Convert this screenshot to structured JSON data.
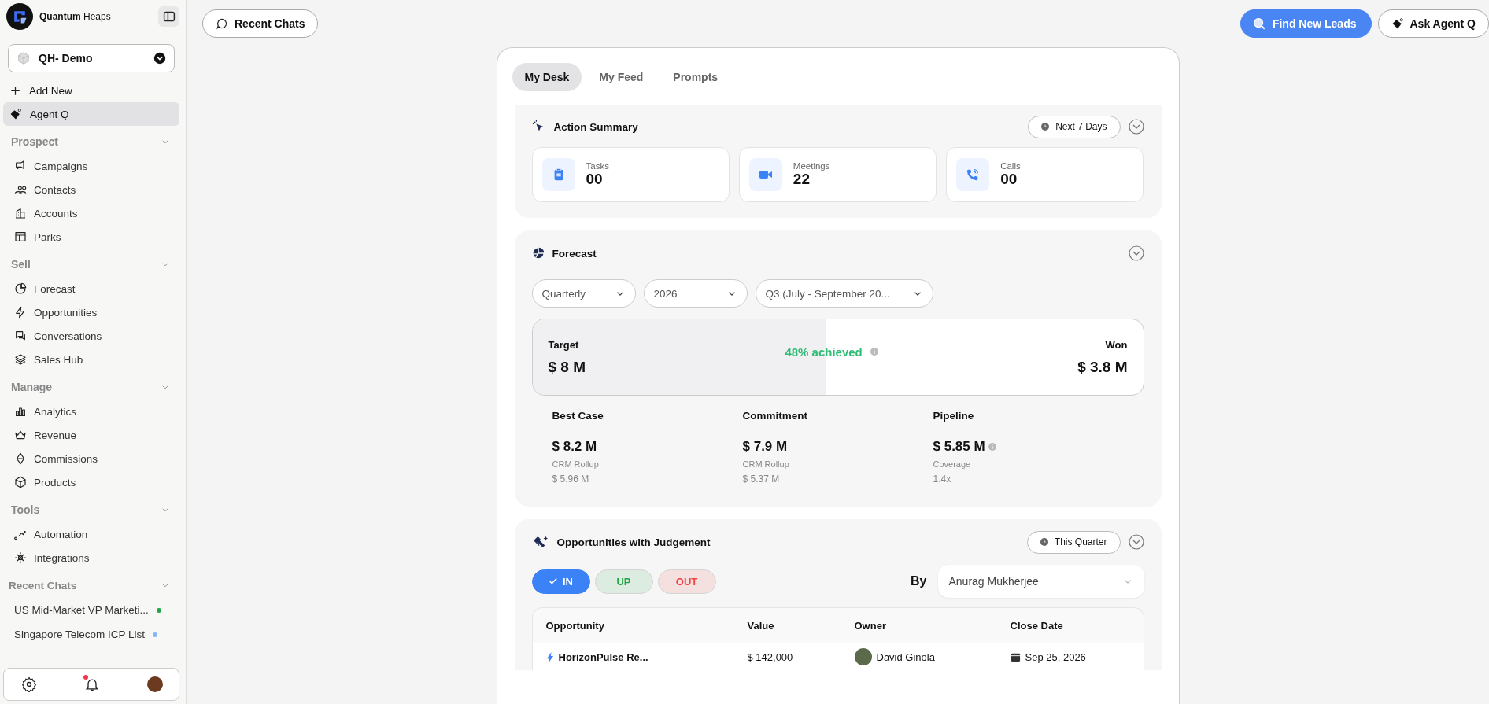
{
  "brand": {
    "name_bold": "Quantum",
    "name_light": "Heaps"
  },
  "workspace": {
    "label": "QH- Demo"
  },
  "add_new": "Add New",
  "agent": {
    "label": "Agent Q",
    "selected": true
  },
  "sections": [
    {
      "title": "Prospect",
      "expanded": true,
      "items": [
        {
          "label": "Campaigns"
        },
        {
          "label": "Contacts"
        },
        {
          "label": "Accounts"
        },
        {
          "label": "Parks"
        }
      ]
    },
    {
      "title": "Sell",
      "expanded": true,
      "items": [
        {
          "label": "Forecast"
        },
        {
          "label": "Opportunities"
        },
        {
          "label": "Conversations"
        },
        {
          "label": "Sales Hub"
        }
      ]
    },
    {
      "title": "Manage",
      "expanded": true,
      "items": [
        {
          "label": "Analytics"
        },
        {
          "label": "Revenue"
        },
        {
          "label": "Commissions"
        },
        {
          "label": "Products"
        }
      ]
    },
    {
      "title": "Tools",
      "expanded": true,
      "items": [
        {
          "label": "Automation"
        },
        {
          "label": "Integrations"
        }
      ]
    }
  ],
  "recent_chats": {
    "title": "Recent Chats",
    "expanded": true,
    "items": [
      {
        "label": "US Mid-Market VP Marketi...",
        "color": "#22a447"
      },
      {
        "label": "Singapore Telecom ICP List",
        "color": "#8ab4f8"
      }
    ]
  },
  "footer": {
    "bell_unread": true
  },
  "topbar": {
    "recent_chats": "Recent Chats",
    "find_leads": "Find New Leads",
    "ask_agent": "Ask Agent Q"
  },
  "tabs": [
    {
      "label": "My Desk",
      "selected": true
    },
    {
      "label": "My Feed",
      "selected": false
    },
    {
      "label": "Prompts",
      "selected": false
    }
  ],
  "action_summary": {
    "title": "Action Summary",
    "period": "Next 7 Days",
    "expanded": true,
    "cards": [
      {
        "label": "Tasks",
        "value": "00"
      },
      {
        "label": "Meetings",
        "value": "22"
      },
      {
        "label": "Calls",
        "value": "00"
      }
    ]
  },
  "forecast": {
    "title": "Forecast",
    "expanded": true,
    "filters": [
      {
        "value": "Quarterly"
      },
      {
        "value": "2026"
      },
      {
        "value": "Q3 (July - September 20..."
      }
    ],
    "target_label": "Target",
    "target_value": "$ 8 M",
    "achieved": "48% achieved",
    "level": 0.48,
    "won_label": "Won",
    "won_value": "$ 3.8 M",
    "metrics": [
      {
        "label": "Best Case",
        "value": "$ 8.2 M",
        "sub_label": "CRM Rollup",
        "sub_value": "$ 5.96 M",
        "info": false
      },
      {
        "label": "Commitment",
        "value": "$ 7.9 M",
        "sub_label": "CRM Rollup",
        "sub_value": "$ 5.37 M",
        "info": false
      },
      {
        "label": "Pipeline",
        "value": "$ 5.85 M",
        "sub_label": "Coverage",
        "sub_value": "1.4x",
        "info": true
      }
    ]
  },
  "judgement": {
    "title": "Opportunities with Judgement",
    "period": "This Quarter",
    "expanded": true,
    "chips": [
      {
        "label": "IN",
        "selected": true,
        "color": "#3b82f6"
      },
      {
        "label": "UP",
        "selected": false,
        "color": "#22a447"
      },
      {
        "label": "OUT",
        "selected": false,
        "color": "#ef4444"
      }
    ],
    "by_label": "By",
    "owner_select": "Anurag Mukherjee",
    "columns": [
      "Opportunity",
      "Value",
      "Owner",
      "Close Date"
    ],
    "rows": [
      {
        "opportunity": "HorizonPulse Re...",
        "value": "$ 142,000",
        "owner": "David Ginola",
        "close_date": "Sep 25, 2026"
      }
    ]
  }
}
